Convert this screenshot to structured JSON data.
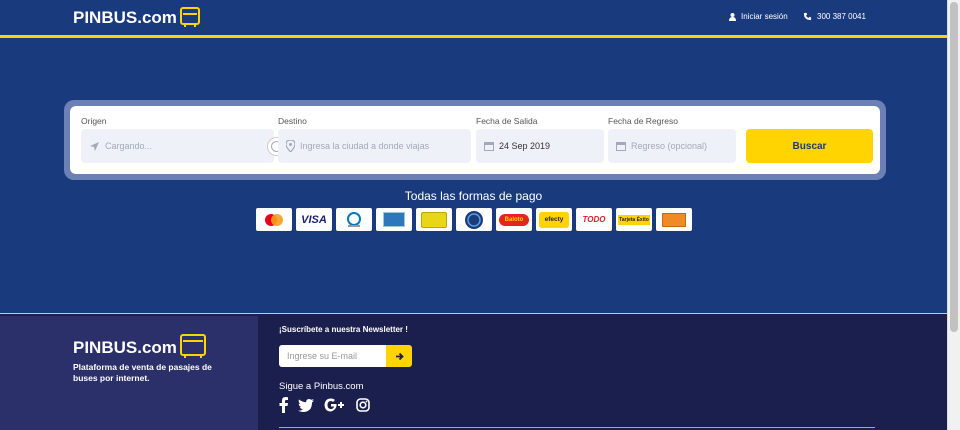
{
  "header": {
    "brand": "PINBUS.com",
    "login_label": "Iniciar sesión",
    "phone": "300 387 0041"
  },
  "search": {
    "origin_label": "Origen",
    "origin_value": "Cargando...",
    "destination_label": "Destino",
    "destination_placeholder": "Ingresa la ciudad a donde viajas",
    "departure_label": "Fecha de Salida",
    "departure_value": "24 Sep 2019",
    "return_label": "Fecha de Regreso",
    "return_placeholder": "Regreso (opcional)",
    "search_button": "Buscar"
  },
  "payments": {
    "title": "Todas las formas de pago",
    "methods": [
      "Mastercard",
      "VISA",
      "Diners Club",
      "American Express",
      "Credencial",
      "PSE",
      "Baloto",
      "efecty",
      "TODO",
      "Tarjeta Éxito",
      "Gana"
    ],
    "labels": {
      "visa": "VISA",
      "baloto": "Baloto",
      "efecty": "efecty",
      "todo": "TODO",
      "tarjeta_exito": "Tarjeta Éxito"
    }
  },
  "footer": {
    "brand": "PINBUS.com",
    "tagline": "Plataforma de venta de pasajes de buses por internet.",
    "newsletter_title": "¡Suscríbete a nuestra Newsletter !",
    "email_placeholder": "Ingrese su E-mail",
    "follow_label": "Sigue a Pinbus.com",
    "social": [
      "facebook",
      "twitter",
      "google-plus",
      "instagram"
    ]
  },
  "colors": {
    "primary_blue": "#1a3a7e",
    "accent_yellow": "#ffd400",
    "footer_dark": "#1b1f4e",
    "footer_left": "#2b306b"
  }
}
